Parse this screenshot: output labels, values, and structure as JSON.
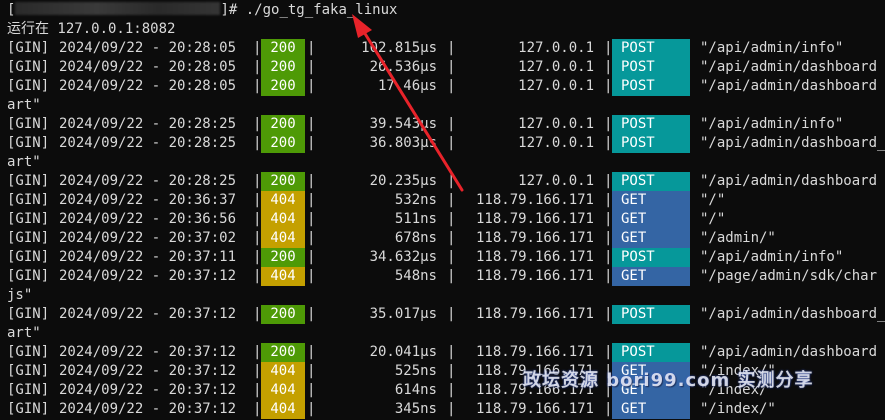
{
  "prompt": {
    "open": "[",
    "close": "]#",
    "command": "./go_tg_faka_linux"
  },
  "startup": "运行在 127.0.0.1:8082",
  "separator": "|",
  "colors": {
    "background": "#0c0c0c",
    "text": "#d9d9d9",
    "status_200": "#4e9a06",
    "status_404": "#c4a000",
    "method_post": "#06989a",
    "method_get": "#3465a4",
    "annotation_arrow": "#e8232a"
  },
  "log": {
    "columns": [
      "tag",
      "datetime",
      "status",
      "latency",
      "client_ip",
      "method",
      "path"
    ],
    "rows": [
      {
        "type": "entry",
        "tag": "[GIN]",
        "date": "2024/09/22 - 20:28:05",
        "status": "200",
        "latency": "102.815µs",
        "ip": "127.0.0.1",
        "method": "POST",
        "path": "\"/api/admin/info\""
      },
      {
        "type": "entry",
        "tag": "[GIN]",
        "date": "2024/09/22 - 20:28:05",
        "status": "200",
        "latency": "26.536µs",
        "ip": "127.0.0.1",
        "method": "POST",
        "path": "\"/api/admin/dashboard"
      },
      {
        "type": "entry",
        "tag": "[GIN]",
        "date": "2024/09/22 - 20:28:05",
        "status": "200",
        "latency": "17.46µs",
        "ip": "127.0.0.1",
        "method": "POST",
        "path": "\"/api/admin/dashboard"
      },
      {
        "type": "wrap",
        "text": "art\""
      },
      {
        "type": "entry",
        "tag": "[GIN]",
        "date": "2024/09/22 - 20:28:25",
        "status": "200",
        "latency": "39.543µs",
        "ip": "127.0.0.1",
        "method": "POST",
        "path": "\"/api/admin/info\""
      },
      {
        "type": "entry",
        "tag": "[GIN]",
        "date": "2024/09/22 - 20:28:25",
        "status": "200",
        "latency": "36.803µs",
        "ip": "127.0.0.1",
        "method": "POST",
        "path": "\"/api/admin/dashboard_"
      },
      {
        "type": "wrap",
        "text": "art\""
      },
      {
        "type": "entry",
        "tag": "[GIN]",
        "date": "2024/09/22 - 20:28:25",
        "status": "200",
        "latency": "20.235µs",
        "ip": "127.0.0.1",
        "method": "POST",
        "path": "\"/api/admin/dashboard"
      },
      {
        "type": "entry",
        "tag": "[GIN]",
        "date": "2024/09/22 - 20:36:37",
        "status": "404",
        "latency": "532ns",
        "ip": "118.79.166.171",
        "method": "GET",
        "path": "\"/\""
      },
      {
        "type": "entry",
        "tag": "[GIN]",
        "date": "2024/09/22 - 20:36:56",
        "status": "404",
        "latency": "511ns",
        "ip": "118.79.166.171",
        "method": "GET",
        "path": "\"/\""
      },
      {
        "type": "entry",
        "tag": "[GIN]",
        "date": "2024/09/22 - 20:37:02",
        "status": "404",
        "latency": "678ns",
        "ip": "118.79.166.171",
        "method": "GET",
        "path": "\"/admin/\""
      },
      {
        "type": "entry",
        "tag": "[GIN]",
        "date": "2024/09/22 - 20:37:11",
        "status": "200",
        "latency": "34.632µs",
        "ip": "118.79.166.171",
        "method": "POST",
        "path": "\"/api/admin/info\""
      },
      {
        "type": "entry",
        "tag": "[GIN]",
        "date": "2024/09/22 - 20:37:12",
        "status": "404",
        "latency": "548ns",
        "ip": "118.79.166.171",
        "method": "GET",
        "path": "\"/page/admin/sdk/char"
      },
      {
        "type": "wrap",
        "text": "js\""
      },
      {
        "type": "entry",
        "tag": "[GIN]",
        "date": "2024/09/22 - 20:37:12",
        "status": "200",
        "latency": "35.017µs",
        "ip": "118.79.166.171",
        "method": "POST",
        "path": "\"/api/admin/dashboard_"
      },
      {
        "type": "wrap",
        "text": "art\""
      },
      {
        "type": "entry",
        "tag": "[GIN]",
        "date": "2024/09/22 - 20:37:12",
        "status": "200",
        "latency": "20.041µs",
        "ip": "118.79.166.171",
        "method": "POST",
        "path": "\"/api/admin/dashboard"
      },
      {
        "type": "entry",
        "tag": "[GIN]",
        "date": "2024/09/22 - 20:37:12",
        "status": "404",
        "latency": "525ns",
        "ip": "118.79.166.171",
        "method": "GET",
        "path": "\"/index/\""
      },
      {
        "type": "entry",
        "tag": "[GIN]",
        "date": "2024/09/22 - 20:37:12",
        "status": "404",
        "latency": "614ns",
        "ip": "118.79.166.171",
        "method": "GET",
        "path": "\"/index/\""
      },
      {
        "type": "entry",
        "tag": "[GIN]",
        "date": "2024/09/22 - 20:37:12",
        "status": "404",
        "latency": "345ns",
        "ip": "118.79.166.171",
        "method": "GET",
        "path": "\"/index/\""
      }
    ]
  },
  "watermark": "政坛资源 bori99.com 实测分享"
}
